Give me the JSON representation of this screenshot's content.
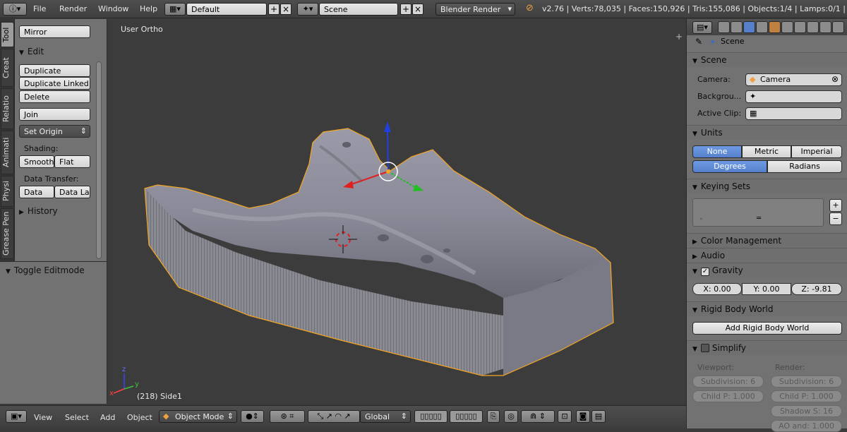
{
  "top_bar": {
    "menus": [
      "File",
      "Render",
      "Window",
      "Help"
    ],
    "layout": "Default",
    "scene": "Scene",
    "engine": "Blender Render",
    "stats": "v2.76 | Verts:78,035 | Faces:150,926 | Tris:155,086 | Objects:1/4 | Lamps:0/1 | Mem"
  },
  "left_tabs": [
    "Tool",
    "Creat",
    "Relatio",
    "Animati",
    "Physi",
    "Grease Pen"
  ],
  "tool_panel": {
    "mirror": "Mirror",
    "edit_header": "Edit",
    "duplicate": "Duplicate",
    "duplicate_linked": "Duplicate Linked",
    "delete": "Delete",
    "join": "Join",
    "set_origin": "Set Origin",
    "shading_label": "Shading:",
    "smooth": "Smooth",
    "flat": "Flat",
    "data_transfer_label": "Data Transfer:",
    "data": "Data",
    "data_layers": "Data La",
    "history": "History",
    "toggle_editmode": "Toggle Editmode"
  },
  "viewport": {
    "view_label": "User Ortho",
    "frame_label": "(218) Side1",
    "axis_z": "z",
    "axis_y": "y",
    "axis_x": "x"
  },
  "bottom_bar": {
    "menus": [
      "View",
      "Select",
      "Add",
      "Object"
    ],
    "mode": "Object Mode",
    "orientation": "Global"
  },
  "properties": {
    "context": "Scene",
    "scene_section": "Scene",
    "camera_label": "Camera:",
    "camera_value": "Camera",
    "background_label": "Backgrou...",
    "active_clip_label": "Active Clip:",
    "units_section": "Units",
    "units_options": [
      "None",
      "Metric",
      "Imperial"
    ],
    "angle_options": [
      "Degrees",
      "Radians"
    ],
    "keying_sets_section": "Keying Sets",
    "keying_add": "+",
    "keying_remove": "−",
    "color_management": "Color Management",
    "audio": "Audio",
    "gravity": "Gravity",
    "gravity_x": "X:  0.00",
    "gravity_y": "Y:  0.00",
    "gravity_z": "Z:  -9.81",
    "rigid_body_world": "Rigid Body World",
    "add_rigid_body_world": "Add Rigid Body World",
    "simplify": "Simplify",
    "viewport_label": "Viewport:",
    "render_label": "Render:",
    "vp_subdivision": "Subdivision:  6",
    "vp_child": "Child P:  1.000",
    "r_subdivision": "Subdivision:  6",
    "r_child": "Child P:  1.000",
    "r_shadow": "Shadow S:  16",
    "r_ao": "AO and:  1.000"
  },
  "colors": {
    "accent_blue": "#5680cb",
    "selection_outline": "#f5a623",
    "panel_bg": "#727272",
    "viewport_bg": "#3c3c3c"
  }
}
